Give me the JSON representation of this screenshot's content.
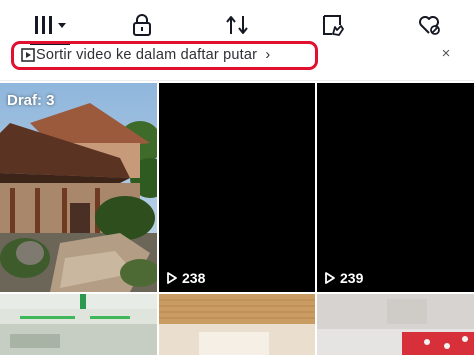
{
  "tabs": [
    {
      "name": "grid-tab",
      "icon": "grid-menu-icon",
      "active": true
    },
    {
      "name": "private-tab",
      "icon": "lock-icon"
    },
    {
      "name": "reposts-tab",
      "icon": "repost-arrows-icon"
    },
    {
      "name": "favorites-tab",
      "icon": "bookmark-hand-icon"
    },
    {
      "name": "liked-tab",
      "icon": "heart-hidden-icon"
    }
  ],
  "banner": {
    "text": "Sortir video ke dalam daftar putar",
    "chevron": "›",
    "close": "×",
    "highlight_color": "#e0102e"
  },
  "grid": {
    "draft_label": "Draf: 3",
    "videos": [
      {
        "views": "238"
      },
      {
        "views": "239"
      }
    ]
  }
}
